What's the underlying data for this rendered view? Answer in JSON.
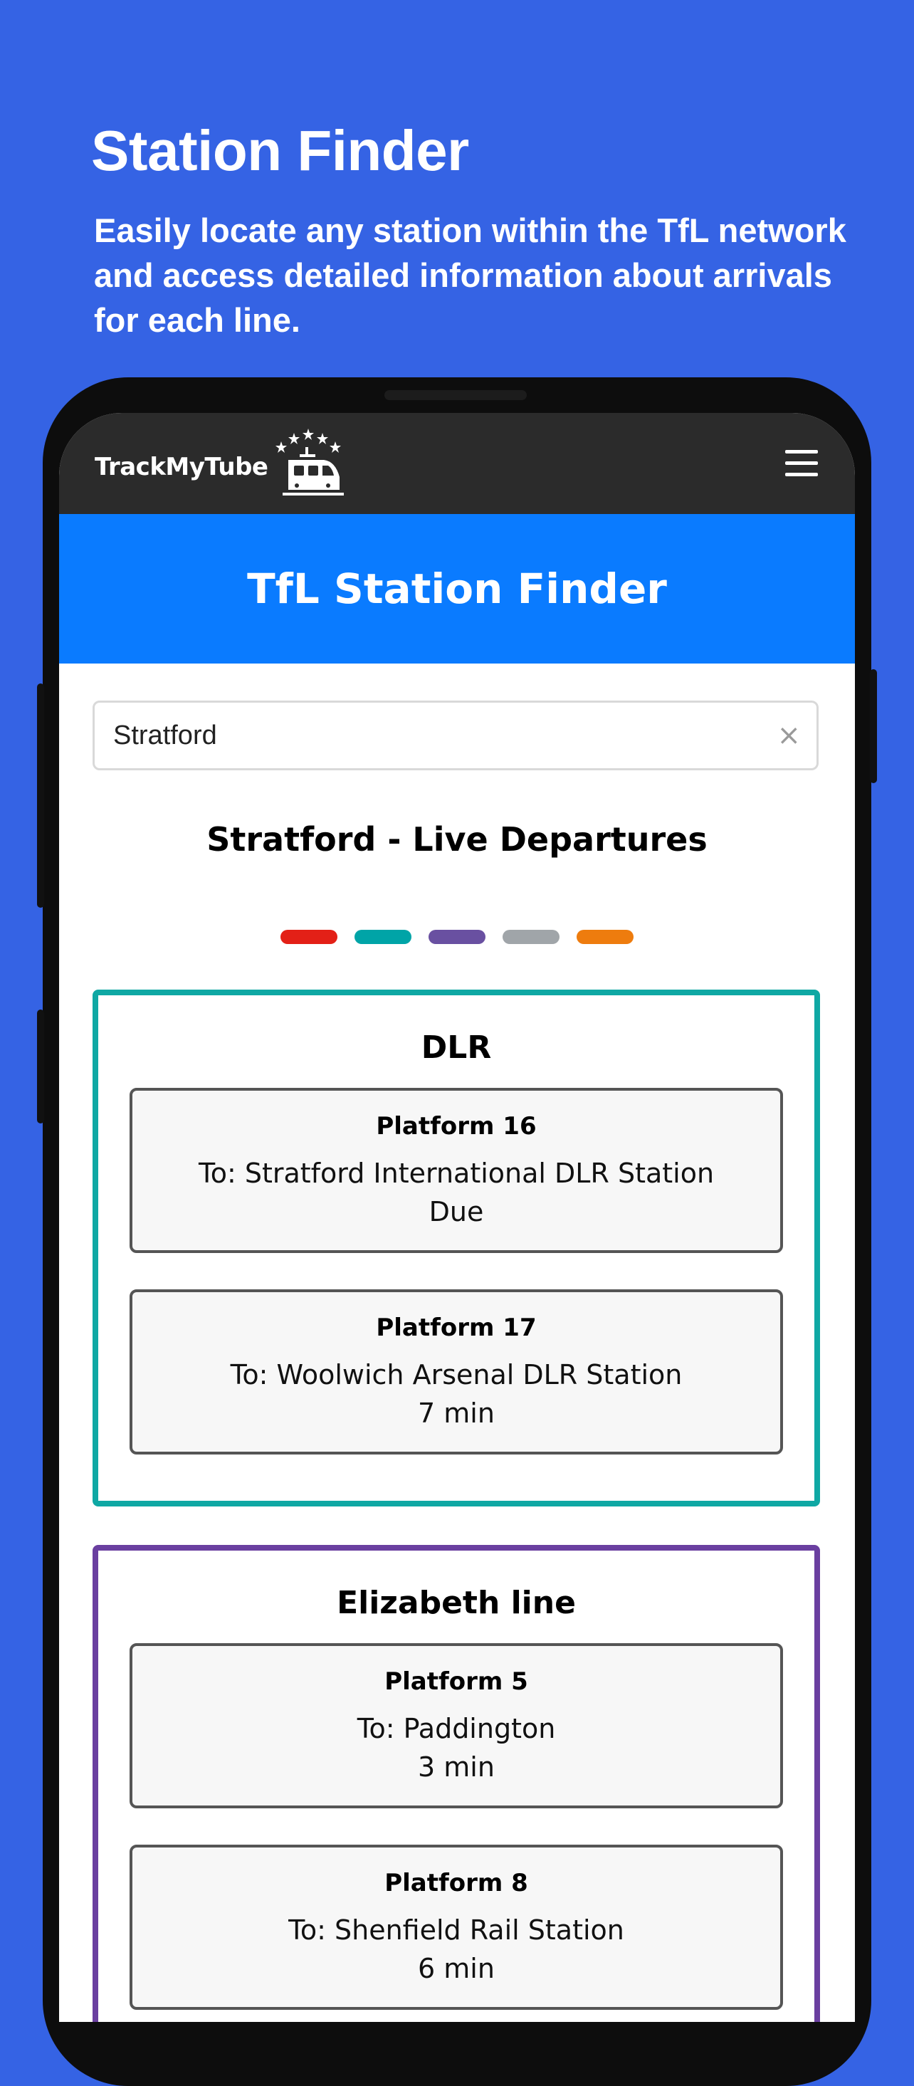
{
  "promo": {
    "title": "Station Finder",
    "subtitle": "Easily locate any station within the TfL network and access detailed information about arrivals for each line."
  },
  "app": {
    "logo_text": "TrackMyTube",
    "menu_icon": "hamburger-menu-icon",
    "banner_title": "TfL Station Finder"
  },
  "search": {
    "value": "Stratford",
    "clear_glyph": "×"
  },
  "departures": {
    "title": "Stratford - Live Departures",
    "line_colors": [
      "#E32017",
      "#00A4A7",
      "#6950A1",
      "#A0A5A9",
      "#EE7C0E"
    ],
    "lines": [
      {
        "name": "DLR",
        "color": "#0FA8A4",
        "platforms": [
          {
            "platform": "Platform 16",
            "destination": "To: Stratford International DLR Station",
            "time": "Due"
          },
          {
            "platform": "Platform 17",
            "destination": "To: Woolwich Arsenal DLR Station",
            "time": "7 min"
          }
        ]
      },
      {
        "name": "Elizabeth line",
        "color": "#6A3FA0",
        "platforms": [
          {
            "platform": "Platform 5",
            "destination": "To: Paddington",
            "time": "3 min"
          },
          {
            "platform": "Platform 8",
            "destination": "To: Shenfield Rail Station",
            "time": "6 min"
          }
        ]
      }
    ]
  }
}
